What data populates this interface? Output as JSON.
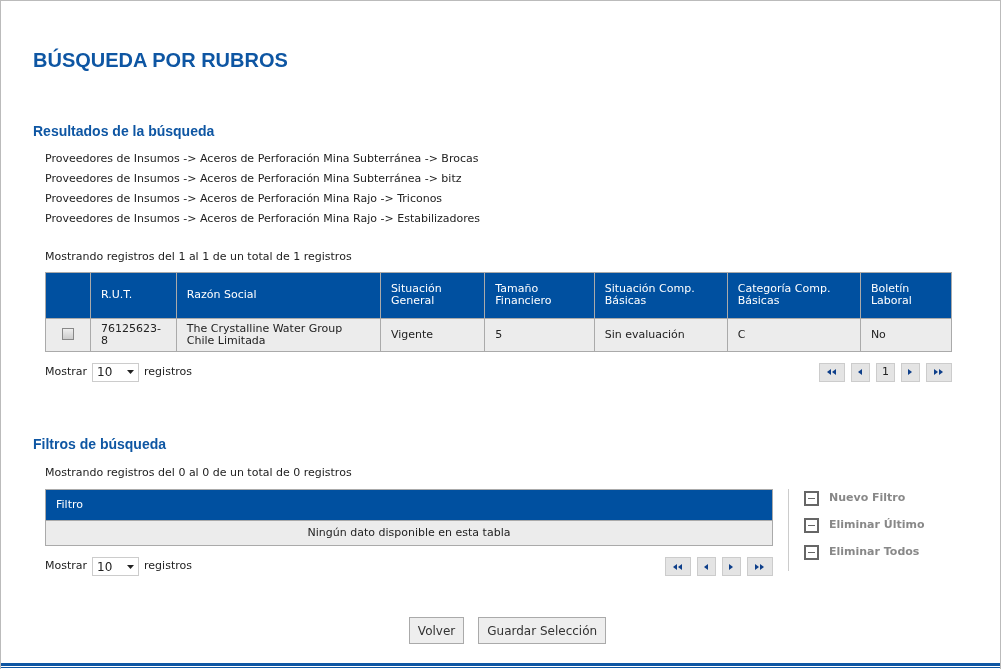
{
  "title": "BÚSQUEDA POR RUBROS",
  "results": {
    "heading": "Resultados de la búsqueda",
    "paths": [
      "Proveedores de Insumos -> Aceros de Perforación Mina Subterránea -> Brocas",
      "Proveedores de Insumos -> Aceros de Perforación Mina Subterránea -> bitz",
      "Proveedores de Insumos -> Aceros de Perforación Mina Rajo -> Triconos",
      "Proveedores de Insumos -> Aceros de Perforación Mina Rajo -> Estabilizadores"
    ],
    "info": "Mostrando registros del 1 al 1 de un total de 1 registros",
    "table": {
      "columns": [
        "R.U.T.",
        "Razón Social",
        "Situación General",
        "Tamaño Financiero",
        "Situación Comp. Básicas",
        "Categoría Comp. Básicas",
        "Boletín Laboral"
      ],
      "rows": [
        {
          "checked": false,
          "cells": [
            "76125623-8",
            "The Crystalline Water Group Chile Limitada",
            "Vigente",
            "5",
            "Sin evaluación",
            "C",
            "No"
          ]
        }
      ]
    },
    "length": {
      "label_before": "Mostrar",
      "value": "10",
      "label_after": "registros"
    },
    "pages": [
      "1"
    ]
  },
  "filters": {
    "heading": "Filtros de búsqueda",
    "info": "Mostrando registros del 0 al 0 de un total de 0 registros",
    "table": {
      "columns": [
        "Filtro"
      ],
      "empty": "Ningún dato disponible en esta tabla"
    },
    "length": {
      "label_before": "Mostrar",
      "value": "10",
      "label_after": "registros"
    },
    "actions": [
      "Nuevo Filtro",
      "Eliminar Último",
      "Eliminar Todos"
    ]
  },
  "buttons": [
    "Volver",
    "Guardar Selección"
  ]
}
